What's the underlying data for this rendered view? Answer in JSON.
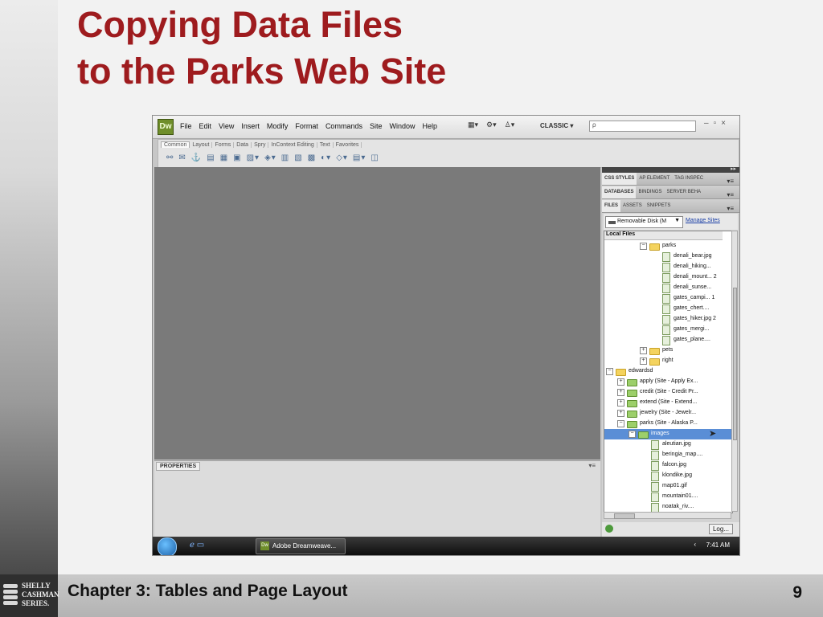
{
  "slide": {
    "title_line1": "Copying Data Files",
    "title_line2": "to the Parks Web Site",
    "footer_title": "Chapter 3: Tables and Page Layout",
    "page_number": "9",
    "series_logo": [
      "SHELLY",
      "CASHMAN",
      "SERIES."
    ]
  },
  "app": {
    "logo": "Dw",
    "menus": [
      "File",
      "Edit",
      "View",
      "Insert",
      "Modify",
      "Format",
      "Commands",
      "Site",
      "Window",
      "Help"
    ],
    "workspace": "CLASSIC ▾",
    "search_placeholder": "ρ",
    "window_controls": [
      "–",
      "▫",
      "×"
    ]
  },
  "insert_bar": {
    "tabs": [
      "Common",
      "Layout",
      "Forms",
      "Data",
      "Spry",
      "InContext Editing",
      "Text",
      "Favorites"
    ],
    "active_tab": "Common"
  },
  "properties": {
    "tab_label": "PROPERTIES"
  },
  "panels": {
    "group1": [
      "CSS STYLES",
      "AP ELEMENT",
      "TAG INSPEC"
    ],
    "group2": [
      "DATABASES",
      "BINDINGS",
      "SERVER BEHA"
    ],
    "group3": [
      "FILES",
      "ASSETS",
      "SNIPPETS"
    ],
    "disk_select": "Removable Disk (M",
    "manage_sites": "Manage Sites",
    "local_files_header": "Local Files",
    "log_button": "Log..."
  },
  "tree": [
    {
      "label": "parks",
      "type": "folder",
      "level": 4,
      "expanded": true
    },
    {
      "label": "denali_bear.jpg",
      "type": "file",
      "level": 5
    },
    {
      "label": "denali_hiking...",
      "type": "file",
      "level": 5
    },
    {
      "label": "denali_mount... 2",
      "type": "file",
      "level": 5
    },
    {
      "label": "denali_sunse...",
      "type": "file",
      "level": 5
    },
    {
      "label": "gates_campi... 1",
      "type": "file",
      "level": 5
    },
    {
      "label": "gates_chert....",
      "type": "file",
      "level": 5
    },
    {
      "label": "gates_hiker.jpg 2",
      "type": "file",
      "level": 5
    },
    {
      "label": "gates_mergi...",
      "type": "file",
      "level": 5
    },
    {
      "label": "gates_plane....",
      "type": "file",
      "level": 5
    },
    {
      "label": "pets",
      "type": "folder",
      "level": 4,
      "expanded": false
    },
    {
      "label": "right",
      "type": "folder",
      "level": 4,
      "expanded": false
    },
    {
      "label": "edwardsd",
      "type": "folder",
      "level": 1,
      "expanded": true
    },
    {
      "label": "apply (Site - Apply Ex...",
      "type": "site",
      "level": 2,
      "expanded": false
    },
    {
      "label": "credit (Site - Credit Pr...",
      "type": "site",
      "level": 2,
      "expanded": false
    },
    {
      "label": "extend (Site - Extend...",
      "type": "site",
      "level": 2,
      "expanded": false
    },
    {
      "label": "jewelry (Site - Jewelr...",
      "type": "site",
      "level": 2,
      "expanded": false
    },
    {
      "label": "parks (Site - Alaska P...",
      "type": "site",
      "level": 2,
      "expanded": true
    },
    {
      "label": "images",
      "type": "site",
      "level": 3,
      "expanded": true,
      "selected": true
    },
    {
      "label": "aleutian.jpg",
      "type": "file",
      "level": 4
    },
    {
      "label": "beringia_map....",
      "type": "file",
      "level": 4
    },
    {
      "label": "falcon.jpg",
      "type": "file",
      "level": 4
    },
    {
      "label": "klondike.jpg",
      "type": "file",
      "level": 4
    },
    {
      "label": "map01.gif",
      "type": "file",
      "level": 4
    },
    {
      "label": "mountain01....",
      "type": "file",
      "level": 4
    },
    {
      "label": "noatak_riv....",
      "type": "file",
      "level": 4
    }
  ],
  "taskbar": {
    "task_label": "Adobe Dreamweave...",
    "task_icon": "Dw",
    "clock": "7:41 AM"
  }
}
